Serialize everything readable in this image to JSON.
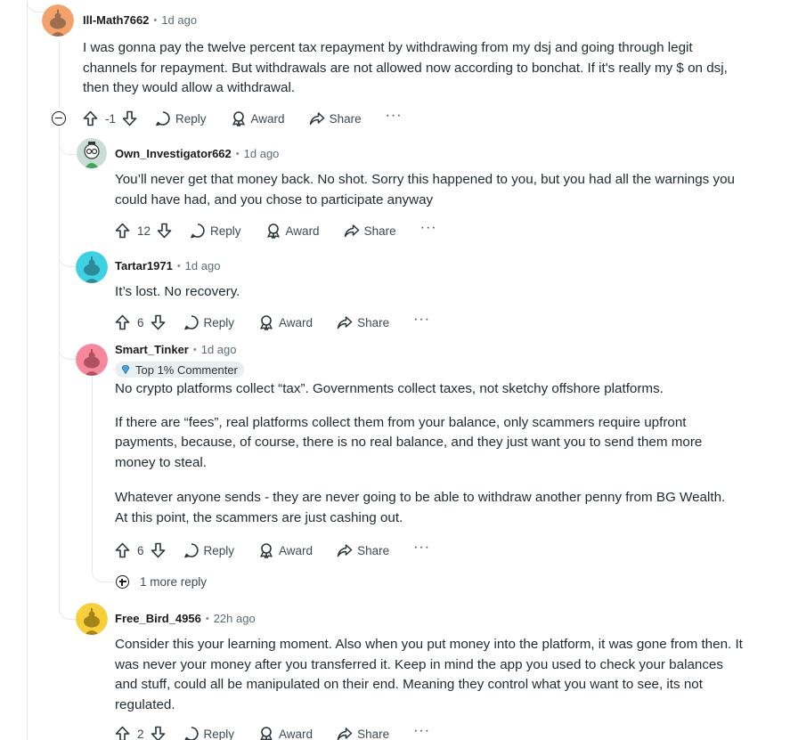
{
  "comments": [
    {
      "user": "Ill-Math7662",
      "time": "1d ago",
      "paragraphs": [
        "I was gonna pay the twelve percent tax repayment by withdrawing from my dsj and going through legit channels for repayment. But withdrawals are not allowed now according to bonchat. If it's really my $ on dsj, then they would allow a withdrawal."
      ],
      "score": "-1",
      "avatar_color": "#f4a26b"
    },
    {
      "user": "Own_Investigator662",
      "time": "1d ago",
      "paragraphs": [
        "You’ll never get that money back. No shot. Sorry this happened to you, but you had all the warnings you could have had, and you chose to participate anyway"
      ],
      "score": "12",
      "avatar_color": "#c9ddd6"
    },
    {
      "user": "Tartar1971",
      "time": "1d ago",
      "paragraphs": [
        "It’s lost. No recovery."
      ],
      "score": "6",
      "avatar_color": "#3ed0e3"
    },
    {
      "user": "Smart_Tinker",
      "time": "1d ago",
      "badge": "Top 1% Commenter",
      "paragraphs": [
        "No crypto platforms collect “tax”. Governments collect taxes, not sketchy offshore platforms.",
        "If there are “fees”, real platforms collect them from your balance, only scammers require upfront payments, because, of course, there is no real balance, and they just want you to send them more money to steal.",
        "Whatever anyone sends - they are never going to be able to withdraw another penny from BG Wealth. At this point, the scammers are just cashing out."
      ],
      "score": "6",
      "avatar_color": "#f5889a",
      "more_replies": "1 more reply"
    },
    {
      "user": "Free_Bird_4956",
      "time": "22h ago",
      "paragraphs": [
        "Consider this your learning moment. Also when you put money into the platform, it was gone from then. It was never your money after you transferred it. Keep in mind the app you used to check your balances and stuff, could all be manipulated on their end. Meaning they control what you want to see, its not regulated."
      ],
      "score": "2",
      "avatar_color": "#f7cf3a"
    }
  ],
  "labels": {
    "reply": "Reply",
    "award": "Award",
    "share": "Share",
    "more": "···",
    "separator": "•"
  }
}
